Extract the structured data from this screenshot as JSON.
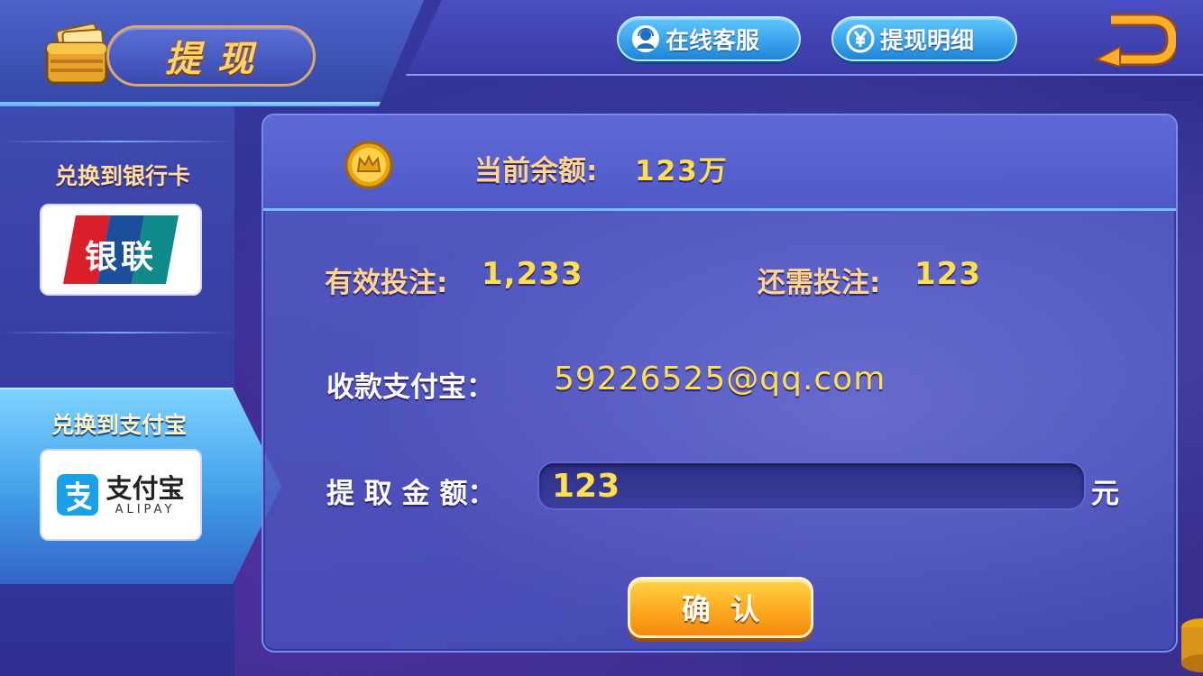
{
  "header": {
    "title": "提现",
    "service_label": "在线客服",
    "detail_label": "提现明细"
  },
  "sidebar": {
    "items": [
      {
        "label": "兑换到银行卡",
        "card_text": "银联",
        "active": false
      },
      {
        "label": "兑换到支付宝",
        "card_text": "支付宝",
        "card_subtext": "ALIPAY",
        "active": true
      }
    ]
  },
  "balance": {
    "label": "当前余额:",
    "value": "123万"
  },
  "bets": {
    "valid_label": "有效投注:",
    "valid_value": "1,233",
    "required_label": "还需投注:",
    "required_value": "123"
  },
  "alipay": {
    "label": "收款支付宝：",
    "value": "59226525@qq.com"
  },
  "withdraw": {
    "label": "提 取 金 额：",
    "value": "123",
    "unit": "元"
  },
  "confirm_label": "确认",
  "colors": {
    "accent_gold": "#ffd58e",
    "value_yellow": "#ffe04a",
    "button_blue": "#1f86d8",
    "button_orange": "#ffae22"
  },
  "icons": {
    "wallet": "wallet-icon",
    "service": "customer-service-icon",
    "detail": "yuan-circle-icon",
    "back": "back-arrow-icon",
    "coin": "crown-coin-icon"
  }
}
